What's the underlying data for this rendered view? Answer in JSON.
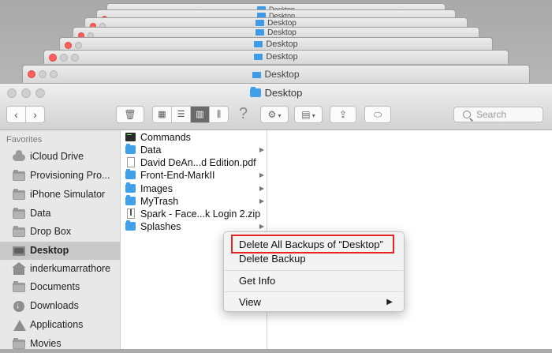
{
  "window": {
    "title": "Desktop"
  },
  "stacked_windows": {
    "title": "Desktop"
  },
  "toolbar": {
    "back_icon": "chevron-left-icon",
    "forward_icon": "chevron-right-icon",
    "trash_icon": "trash-icon",
    "view_modes": [
      "icon-view-icon",
      "list-view-icon",
      "column-view-icon",
      "cover-flow-icon"
    ],
    "active_view": "column-view-icon",
    "help_glyph": "?",
    "search": {
      "placeholder": "Search"
    }
  },
  "sidebar": {
    "heading": "Favorites",
    "items": [
      {
        "label": "iCloud Drive",
        "icon": "cloud-icon"
      },
      {
        "label": "Provisioning Pro...",
        "icon": "folder-icon"
      },
      {
        "label": "iPhone Simulator",
        "icon": "folder-icon"
      },
      {
        "label": "Data",
        "icon": "folder-icon"
      },
      {
        "label": "Drop Box",
        "icon": "folder-icon"
      },
      {
        "label": "Desktop",
        "icon": "desktop-icon",
        "selected": true
      },
      {
        "label": "inderkumarrathore",
        "icon": "home-icon"
      },
      {
        "label": "Documents",
        "icon": "document-icon"
      },
      {
        "label": "Downloads",
        "icon": "download-icon"
      },
      {
        "label": "Applications",
        "icon": "applications-icon"
      },
      {
        "label": "Movies",
        "icon": "movie-icon"
      }
    ]
  },
  "files": [
    {
      "name": "Commands",
      "type": "exec",
      "has_children": false
    },
    {
      "name": "Data",
      "type": "folder",
      "has_children": true
    },
    {
      "name": "David DeAn...d Edition.pdf",
      "type": "pdf",
      "has_children": false
    },
    {
      "name": "Front-End-MarkII",
      "type": "folder",
      "has_children": true
    },
    {
      "name": "Images",
      "type": "folder",
      "has_children": true
    },
    {
      "name": "MyTrash",
      "type": "folder",
      "has_children": true
    },
    {
      "name": "Spark - Face...k Login 2.zip",
      "type": "zip",
      "has_children": false
    },
    {
      "name": "Splashes",
      "type": "folder",
      "has_children": true
    }
  ],
  "context_menu": {
    "items": [
      {
        "label": "Delete All Backups of “Desktop”"
      },
      {
        "label": "Delete Backup"
      },
      {
        "label": "Get Info"
      },
      {
        "label": "View",
        "submenu": true
      }
    ]
  },
  "colors": {
    "highlight": "#e82323",
    "folder": "#41a0ea",
    "close": "#fc605c"
  }
}
